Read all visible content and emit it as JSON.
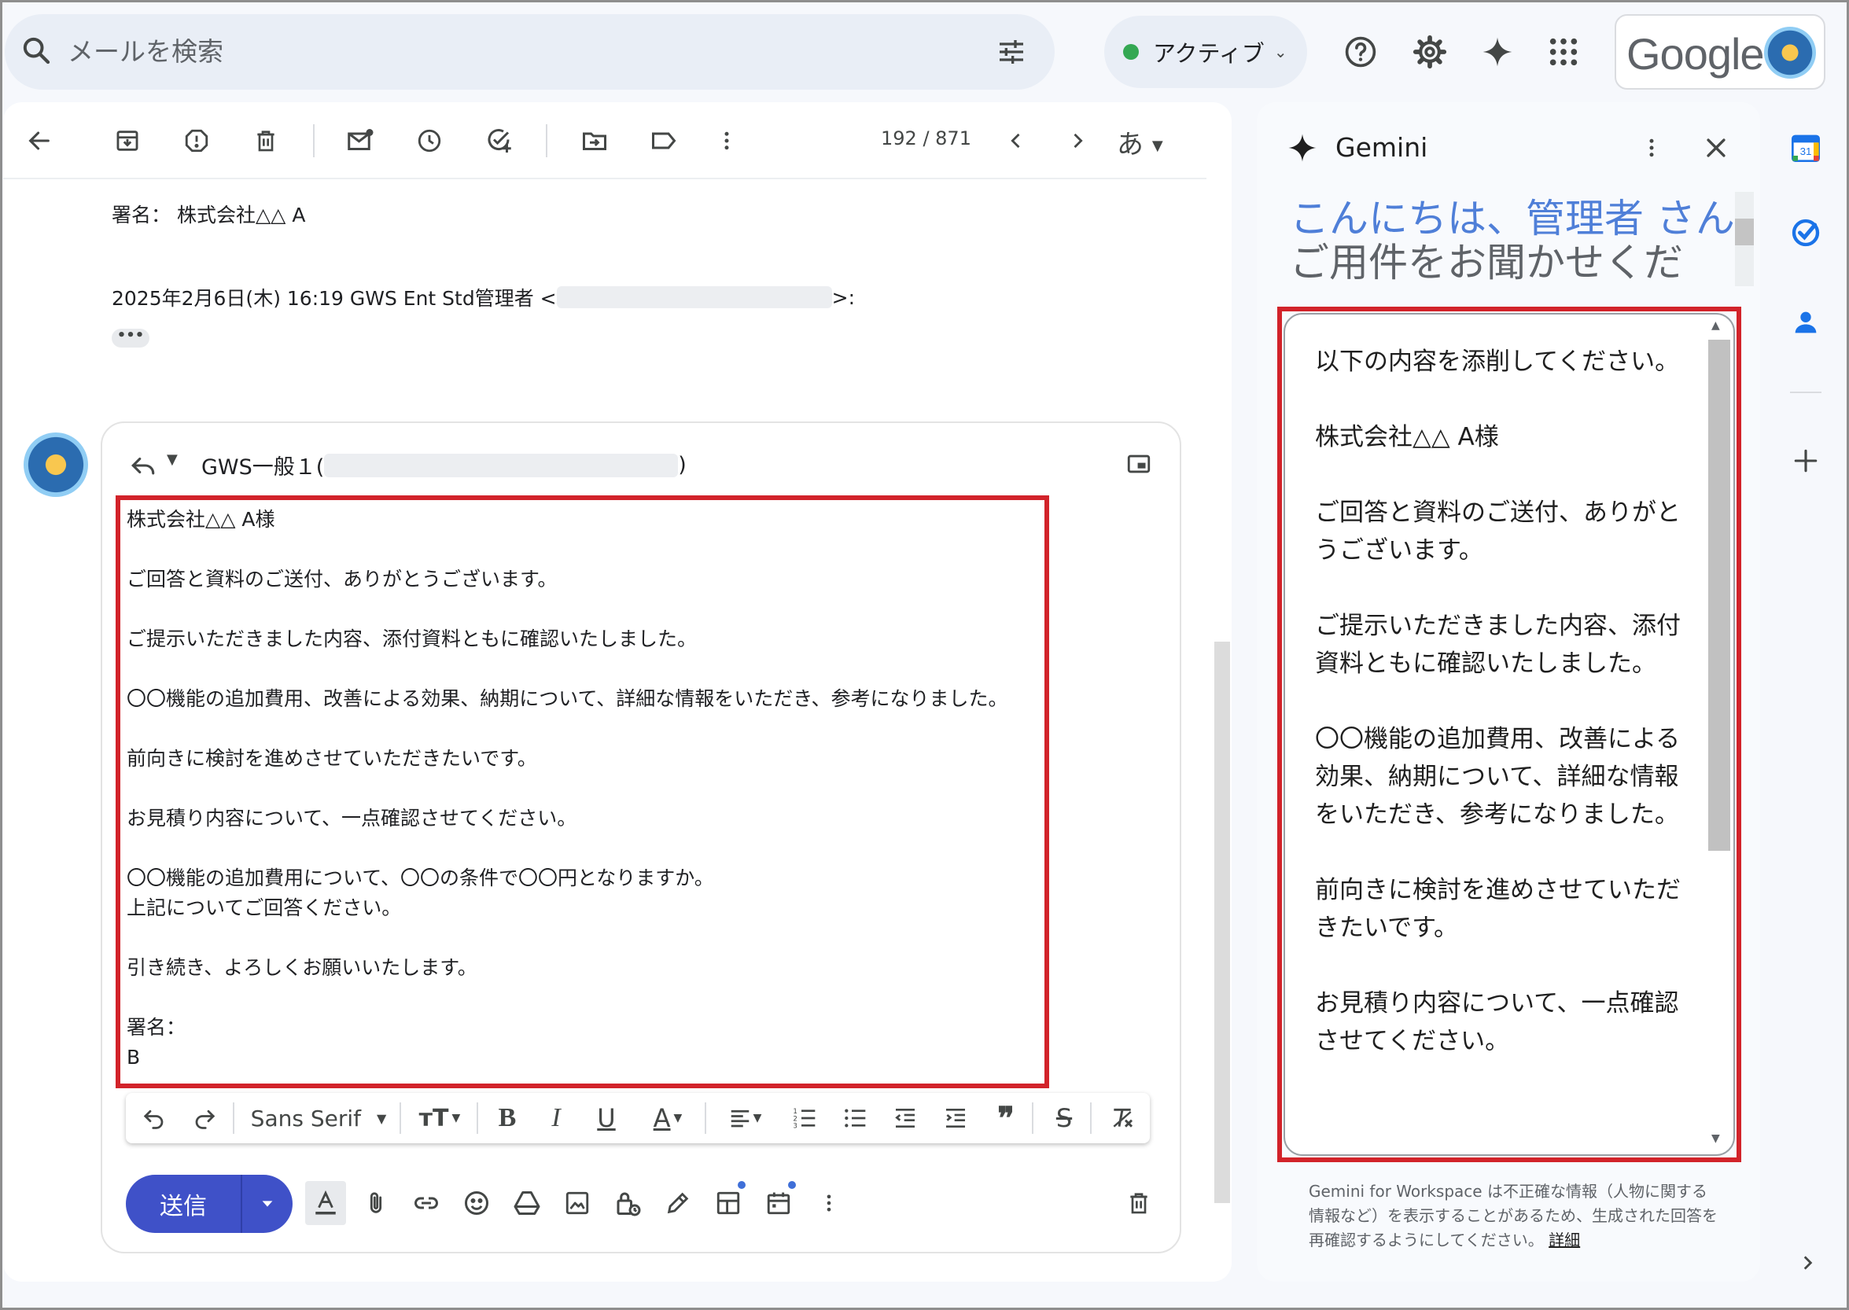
{
  "search": {
    "placeholder": "メールを検索"
  },
  "status": {
    "label": "アクティブ"
  },
  "brand": {
    "logo_text": "Google"
  },
  "mail_toolbar": {
    "page_counter": "192 / 871",
    "lang": "あ"
  },
  "quoted": {
    "signature_line": "署名： 株式会社△△ A",
    "header_prefix": "2025年2月6日(木) 16:19 GWS Ent Std管理者 <",
    "header_suffix": ">:",
    "ellipsis": "•••"
  },
  "compose": {
    "recipient_prefix": "GWS一般１(",
    "recipient_suffix": ")",
    "body": "株式会社△△ A様\n\nご回答と資料のご送付、ありがとうございます。\n\nご提示いただきました内容、添付資料ともに確認いたしました。\n\n〇〇機能の追加費用、改善による効果、納期について、詳細な情報をいただき、参考になりました。\n\n前向きに検討を進めさせていただきたいです。\n\nお見積り内容について、一点確認させてください。\n\n〇〇機能の追加費用について、〇〇の条件で〇〇円となりますか。\n上記についてご回答ください。\n\n引き続き、よろしくお願いいたします。\n\n署名：\nB",
    "font_name": "Sans Serif",
    "send_label": "送信"
  },
  "gemini": {
    "title": "Gemini",
    "greeting_line1": "こんにちは、管理者 さん",
    "greeting_line2": "ご用件をお聞かせくだ",
    "prompt": "以下の内容を添削してください。\n\n株式会社△△ A様\n\nご回答と資料のご送付、ありがとうございます。\n\nご提示いただきました内容、添付資料ともに確認いたしました。\n\n〇〇機能の追加費用、改善による効果、納期について、詳細な情報をいただき、参考になりました。\n\n前向きに検討を進めさせていただきたいです。\n\nお見積り内容について、一点確認させてください。",
    "disclaimer": "Gemini for Workspace は不正確な情報（人物に関する情報など）を表示することがあるため、生成された回答を再確認するようにしてください。",
    "disclaimer_link": "詳細"
  },
  "sidebar": {
    "calendar_day": "31"
  },
  "colors": {
    "highlight": "#d2232a",
    "send": "#3f51c8",
    "accent_blue": "#4f7fd8",
    "status_green": "#34a853"
  }
}
